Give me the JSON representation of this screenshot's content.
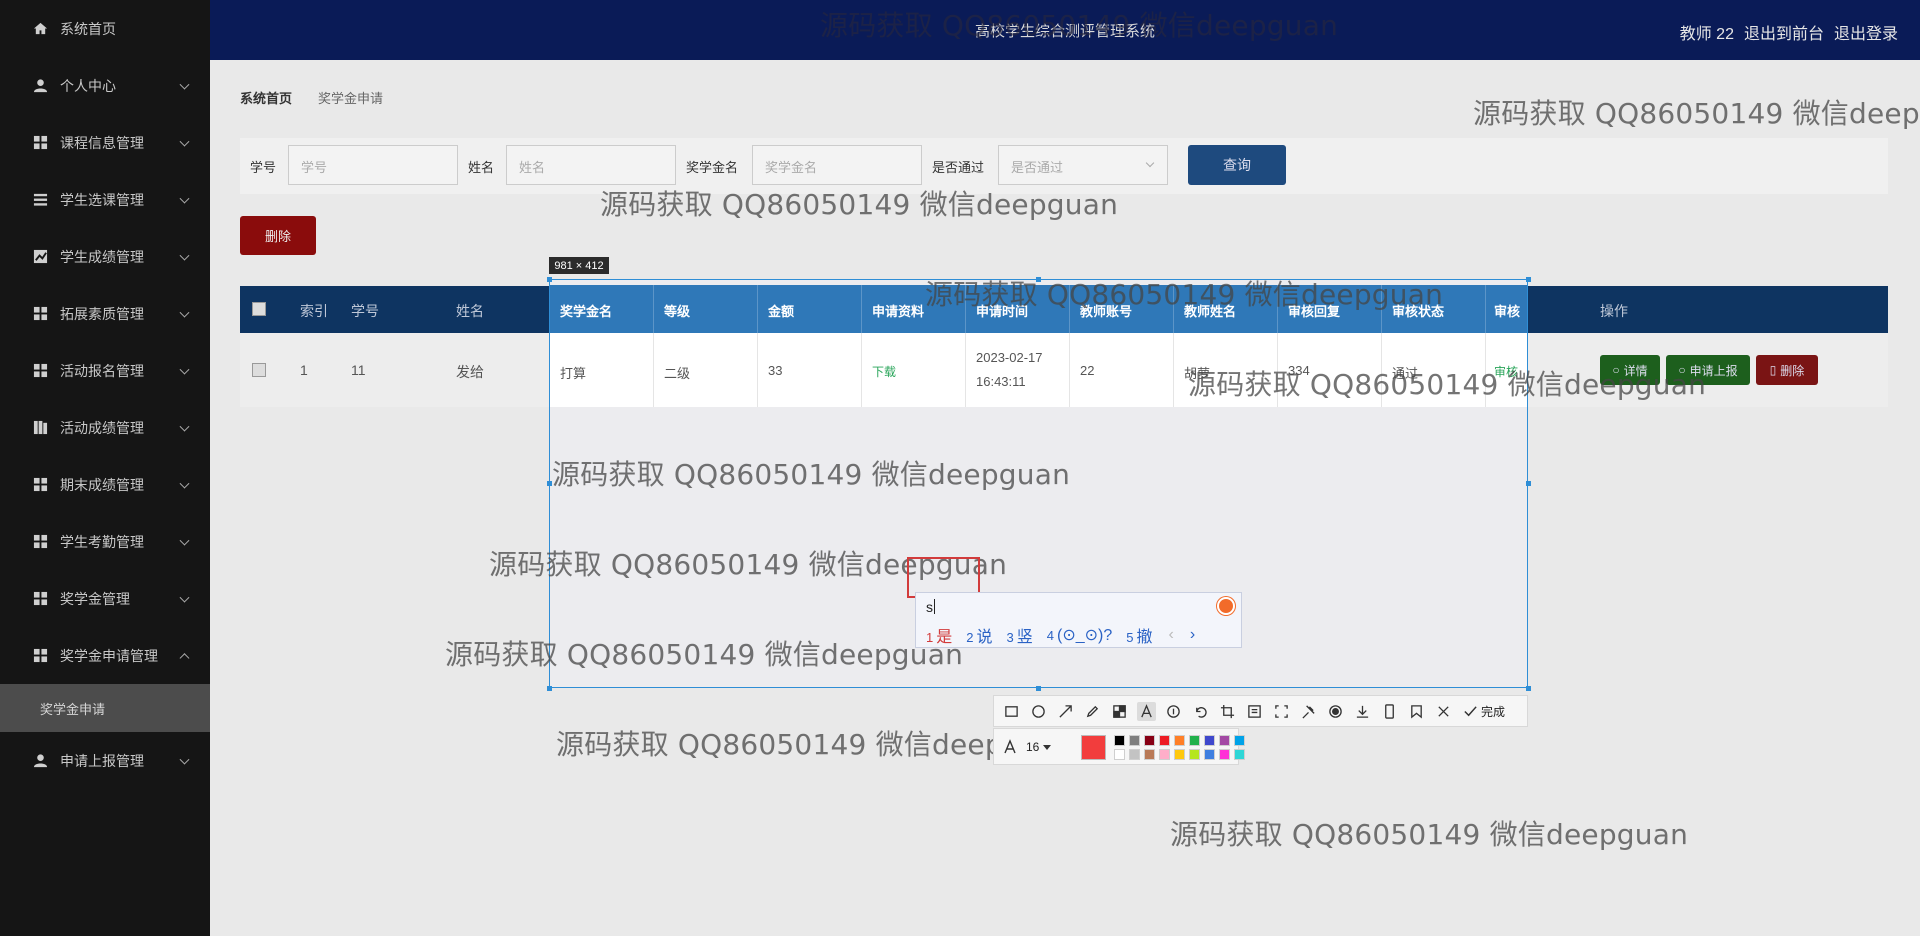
{
  "sidebar": {
    "items": [
      {
        "label": "系统首页",
        "icon": "home-icon"
      },
      {
        "label": "个人中心",
        "icon": "user-icon"
      },
      {
        "label": "课程信息管理",
        "icon": "grid-icon"
      },
      {
        "label": "学生选课管理",
        "icon": "list-icon"
      },
      {
        "label": "学生成绩管理",
        "icon": "chart-icon"
      },
      {
        "label": "拓展素质管理",
        "icon": "grid-icon"
      },
      {
        "label": "活动报名管理",
        "icon": "grid-icon"
      },
      {
        "label": "活动成绩管理",
        "icon": "bookmark-icon"
      },
      {
        "label": "期末成绩管理",
        "icon": "grid-icon"
      },
      {
        "label": "学生考勤管理",
        "icon": "grid-icon"
      },
      {
        "label": "奖学金管理",
        "icon": "grid-icon"
      },
      {
        "label": "奖学金申请管理",
        "icon": "grid-icon"
      },
      {
        "label": "申请上报管理",
        "icon": "user-icon"
      }
    ],
    "sub_item": "奖学金申请"
  },
  "topbar": {
    "title": "高校学生综合测评管理系统",
    "user": "教师 22",
    "back_front": "退出到前台",
    "logout": "退出登录"
  },
  "breadcrumb": {
    "home": "系统首页",
    "current": "奖学金申请"
  },
  "filters": {
    "student_id_label": "学号",
    "student_id_placeholder": "学号",
    "name_label": "姓名",
    "name_placeholder": "姓名",
    "scholarship_label": "奖学金名",
    "scholarship_placeholder": "奖学金名",
    "passed_label": "是否通过",
    "passed_placeholder": "是否通过",
    "query_button": "查询"
  },
  "delete_button": "删除",
  "table": {
    "headers": [
      "索引",
      "学号",
      "姓名",
      "操作"
    ],
    "row": {
      "index": "1",
      "student_id": "11",
      "name": "发给"
    },
    "actions": {
      "detail": "详情",
      "report": "申请上报",
      "delete": "删除"
    }
  },
  "capture": {
    "size_label": "981 × 412",
    "headers": [
      "奖学金名",
      "等级",
      "金额",
      "申请资料",
      "申请时间",
      "教师账号",
      "教师姓名",
      "审核回复",
      "审核状态",
      "审核"
    ],
    "row": {
      "scholarship": "打算",
      "level": "二级",
      "amount": "33",
      "material": "下载",
      "time_date": "2023-02-17",
      "time_clock": "16:43:11",
      "teacher_id": "22",
      "teacher_name": "胡萝",
      "reply": "334",
      "status": "通过",
      "review": "审核"
    }
  },
  "watermark_text": "源码获取 QQ86050149 微信deepguan",
  "ime": {
    "composition": "s",
    "candidates": [
      {
        "n": "1",
        "text": "是"
      },
      {
        "n": "2",
        "text": "说"
      },
      {
        "n": "3",
        "text": "竖"
      },
      {
        "n": "4",
        "text": "(⊙_⊙)?"
      },
      {
        "n": "5",
        "text": "撤"
      }
    ],
    "prev": "‹",
    "next": "›"
  },
  "toolbar": {
    "icons": [
      "rectangle-icon",
      "ellipse-icon",
      "arrow-icon",
      "pen-icon",
      "mosaic-icon",
      "text-icon",
      "number-icon",
      "undo-icon",
      "crop-icon",
      "ocr-icon",
      "long-shot-icon",
      "pin-icon",
      "record-icon",
      "save-icon",
      "phone-icon",
      "bookmark-icon",
      "close-icon"
    ],
    "done_label": "完成"
  },
  "style_bar": {
    "font_size": "16",
    "current_color": "#f23d3d",
    "palette": [
      "#000000",
      "#7f7f7f",
      "#880015",
      "#ed1c24",
      "#ff7f27",
      "#22b14c",
      "#3f48cc",
      "#a349a4",
      "#00a2e8",
      "#ffffff",
      "#c3c3c3",
      "#b97a57",
      "#ffaec9",
      "#ffc90e",
      "#b5e61d",
      "#3f7fe0",
      "#ff2fd6",
      "#2fd6d6"
    ]
  }
}
